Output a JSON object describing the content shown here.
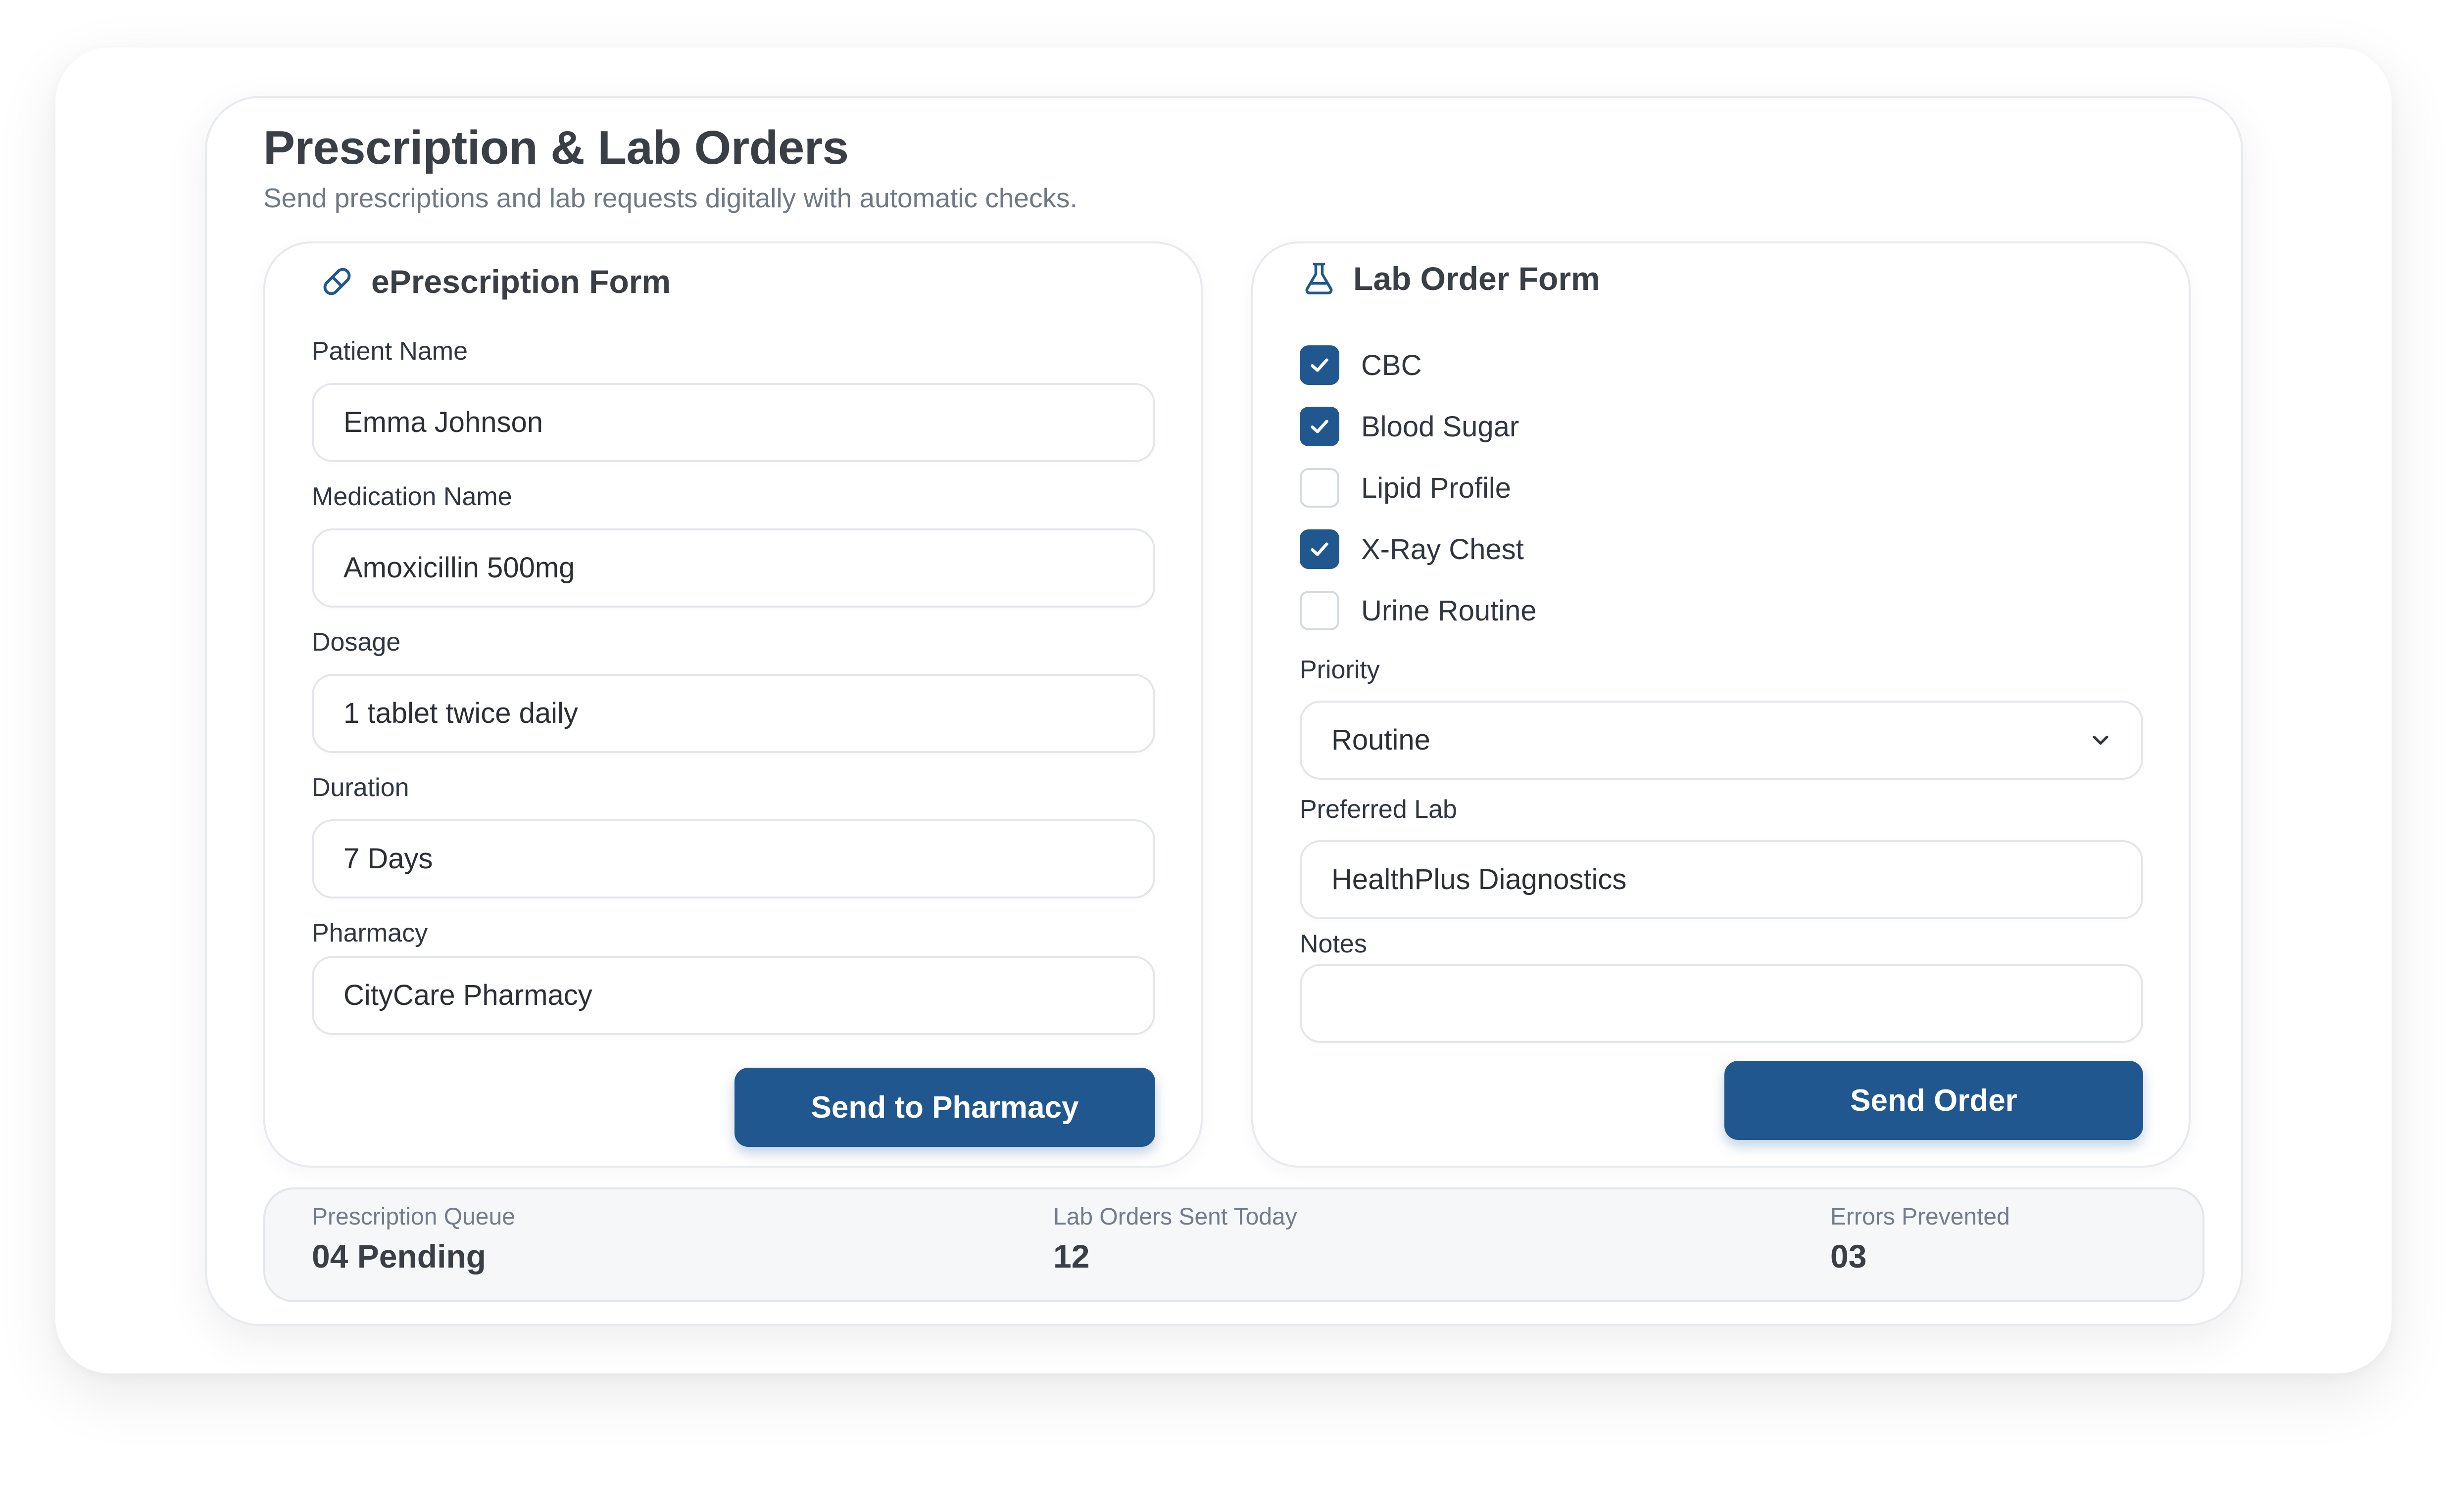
{
  "header": {
    "title": "Prescription & Lab Orders",
    "subtitle": "Send prescriptions and lab requests digitally with automatic checks."
  },
  "eprescription": {
    "title": "ePrescription Form",
    "icon": "pill-icon",
    "fields": {
      "patient_name": {
        "label": "Patient Name",
        "value": "Emma Johnson"
      },
      "medication_name": {
        "label": "Medication Name",
        "value": "Amoxicillin 500mg"
      },
      "dosage": {
        "label": "Dosage",
        "value": "1 tablet twice daily"
      },
      "duration": {
        "label": "Duration",
        "value": "7 Days"
      },
      "pharmacy": {
        "label": "Pharmacy",
        "value": "CityCare Pharmacy"
      }
    },
    "submit_label": "Send to Pharmacy"
  },
  "lab_order": {
    "title": "Lab Order Form",
    "icon": "flask-icon",
    "tests": [
      {
        "label": "CBC",
        "checked": true
      },
      {
        "label": "Blood Sugar",
        "checked": true
      },
      {
        "label": "Lipid Profile",
        "checked": false
      },
      {
        "label": "X-Ray Chest",
        "checked": true
      },
      {
        "label": "Urine Routine",
        "checked": false
      }
    ],
    "priority": {
      "label": "Priority",
      "value": "Routine"
    },
    "preferred_lab": {
      "label": "Preferred Lab",
      "value": "HealthPlus Diagnostics"
    },
    "notes": {
      "label": "Notes",
      "value": ""
    },
    "submit_label": "Send Order"
  },
  "stats": [
    {
      "label": "Prescription Queue",
      "value": "04 Pending"
    },
    {
      "label": "Lab Orders Sent Today",
      "value": "12"
    },
    {
      "label": "Errors Prevented",
      "value": "03"
    }
  ],
  "colors": {
    "primary": "#20578f",
    "title_text": "#3a3f45",
    "muted_text": "#6f7885",
    "border": "#e7eaee",
    "stats_bg": "#f5f7f9"
  }
}
